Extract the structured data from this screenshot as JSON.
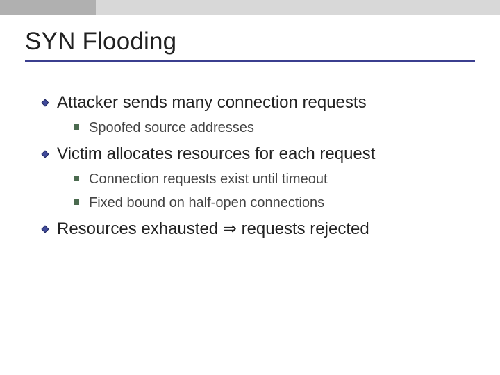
{
  "slide": {
    "title": "SYN Flooding",
    "bullets": [
      {
        "text": "Attacker sends many connection requests",
        "sub": [
          "Spoofed source addresses"
        ]
      },
      {
        "text": "Victim allocates resources for each request",
        "sub": [
          "Connection requests exist until timeout",
          "Fixed bound on half-open connections"
        ]
      },
      {
        "text_html": "Resources exhausted ⇒ requests rejected",
        "sub": []
      }
    ]
  }
}
